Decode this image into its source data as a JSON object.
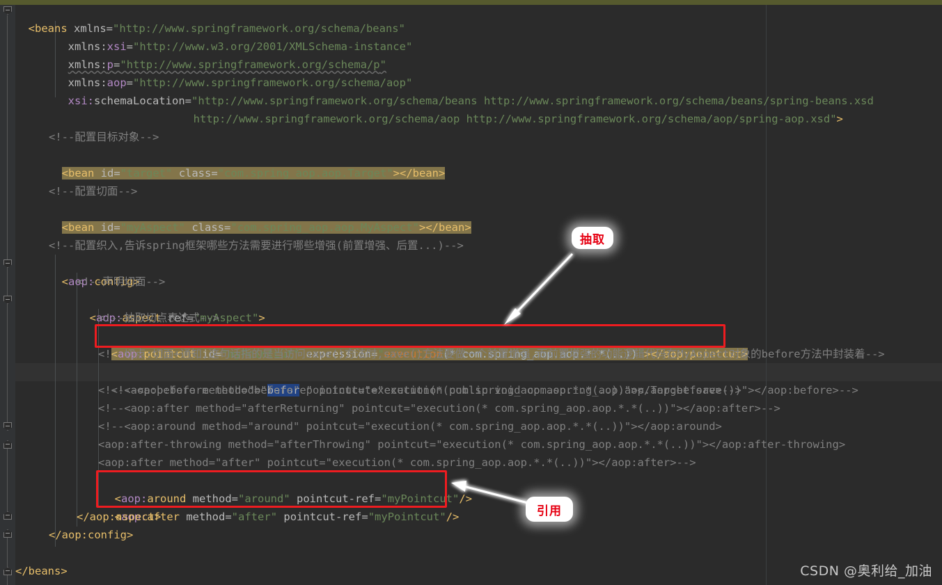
{
  "app": {
    "type": "code-editor",
    "language": "xml",
    "theme": "darcula",
    "colors": {
      "background": "#2b2b2b",
      "gutter": "#313335",
      "current_line": "#323232",
      "marker_bar": "#565a2e",
      "tag": "#e8bf6a",
      "namespace": "#b389c5",
      "string": "#6a8759",
      "comment": "#808080",
      "keyword": "#cc7832",
      "search_highlight": "#83754a",
      "selection": "#214283",
      "annotation_red": "#ee1c20",
      "callout_text": "#e60012"
    }
  },
  "code": {
    "l1": {
      "tag_open": "<beans",
      "attr": " xmlns=",
      "q1": "\"",
      "value": "http://www.springframework.org/schema/beans",
      "q2": "\""
    },
    "l2": {
      "attr_ns": "xmlns:",
      "attr_local": "xsi",
      "eq": "=",
      "q1": "\"",
      "value": "http://www.w3.org/2001/XMLSchema-instance",
      "q2": "\""
    },
    "l3": {
      "attr_ns": "xmlns:",
      "attr_local": "p",
      "eq": "=",
      "q1": "\"",
      "value": "http://www.springframework.org/schema/p",
      "q2": "\""
    },
    "l4": {
      "attr_ns": "xmlns:",
      "attr_local": "aop",
      "eq": "=",
      "q1": "\"",
      "value": "http://www.springframework.org/schema/aop",
      "q2": "\""
    },
    "l5": {
      "attr_ns": "xsi:",
      "attr_local": "schemaLocation",
      "eq": "=",
      "q1": "\"",
      "value": "http://www.springframework.org/schema/beans http://www.springframework.org/schema/beans/spring-beans.xsd"
    },
    "l6": {
      "value": "http://www.springframework.org/schema/aop http://www.springframework.org/schema/aop/spring-aop.xsd",
      "q2": "\"",
      "close": ">"
    },
    "c1": "<!--配置目标对象-->",
    "b1": {
      "open": "<bean",
      "a1": " id=",
      "q1": "\"",
      "v1": "target",
      "q2": "\"",
      "a2": " class=",
      "q3": "\"",
      "v2": "com.spring_aop.aop.Target",
      "q4": "\"",
      "gt": ">",
      "close": "</bean>"
    },
    "c2": "<!--配置切面-->",
    "b2": {
      "open": "<bean",
      "a1": " id=",
      "q1": "\"",
      "v1": "myAspect",
      "q2": "\"",
      "a2": " class=",
      "q3": "\"",
      "v2": "com.spring_aop.aop.MyAspect",
      "q4": "\"",
      "gt": ">",
      "close": "</bean>"
    },
    "c3": "<!--配置织入,告诉spring框架哪些方法需要进行哪些增强(前置增强、后置...)-->",
    "cfg_open": {
      "lt": "<",
      "ns": "aop:",
      "name": "config",
      "gt": ">"
    },
    "c4": "<!--声明切面-->",
    "asp_open": {
      "lt": "<",
      "ns": "aop:",
      "name": "aspect",
      "attr": " ref=",
      "q1": "\"",
      "v": "myAspect",
      "q2": "\"",
      "gt": ">"
    },
    "c5": "<!--抽取切点表达式-->",
    "pointcut": {
      "lt": "<",
      "ns": "aop:",
      "name": "pointcut",
      "a1": " id=",
      "q1": "\"",
      "v1": "myPointcut",
      "q2": "\"",
      "a2": " expression=",
      "q3": "\"",
      "exec": "execution",
      "expr": "(* com.spring_aop.aop.*.*(..))",
      "q4": "\"",
      "gt": ">",
      "close": "</aop:pointcut>"
    },
    "c6": "<!--切点:切面+通知,这句话指的是当访问save()方法时,save()方法要做一个前置增强,而前置增强的功能逻辑代码在MyAspect对象的before方法中封装着-->",
    "c7a": "<!--<aop:before method=\"",
    "c7sel": "befor",
    "c7b": "e\" pointcut=\"execution(public void com.spring_aop.aop.Target.save())\"></aop:before>-->",
    "c8": "<!--<aop:before method=\"before\" pointcut=\"execution(* com.spring_aop.aop.*.*(..))\"></aop:before>-->",
    "c9": "<!--<aop:after method=\"afterReturning\" pointcut=\"execution(* com.spring_aop.aop.*.*(..))\"></aop:after>-->",
    "c10": "<!--<aop:around method=\"around\" pointcut=\"execution(* com.spring_aop.aop.*.*(..))\"></aop:around>",
    "c11": "<aop:after-throwing method=\"afterThrowing\" pointcut=\"execution(* com.spring_aop.aop.*.*(..))\"></aop:after-throwing>",
    "c12": "<aop:after method=\"after\" pointcut=\"execution(* com.spring_aop.aop.*.*(..))\"></aop:after>-->",
    "around": {
      "lt": "<",
      "ns": "aop:",
      "name": "around",
      "a1": " method=",
      "q1": "\"",
      "v1": "around",
      "q2": "\"",
      "a2": " pointcut-ref=",
      "q3": "\"",
      "v2": "myPointcut",
      "q4": "\"",
      "gt": "/>"
    },
    "after": {
      "lt": "<",
      "ns": "aop:",
      "name": "after",
      "a1": " method=",
      "q1": "\"",
      "v1": "after",
      "q2": "\"",
      "a2": " pointcut-ref=",
      "q3": "\"",
      "v2": "myPointcut",
      "q4": "\"",
      "gt": "/>"
    },
    "asp_close": "</aop:aspect>",
    "cfg_close": "</aop:config>",
    "beans_close": "</beans>"
  },
  "annotations": {
    "callout1": {
      "label": "抽取"
    },
    "callout2": {
      "label": "引用"
    }
  },
  "watermark": {
    "text": "CSDN @奥利给_加油"
  }
}
